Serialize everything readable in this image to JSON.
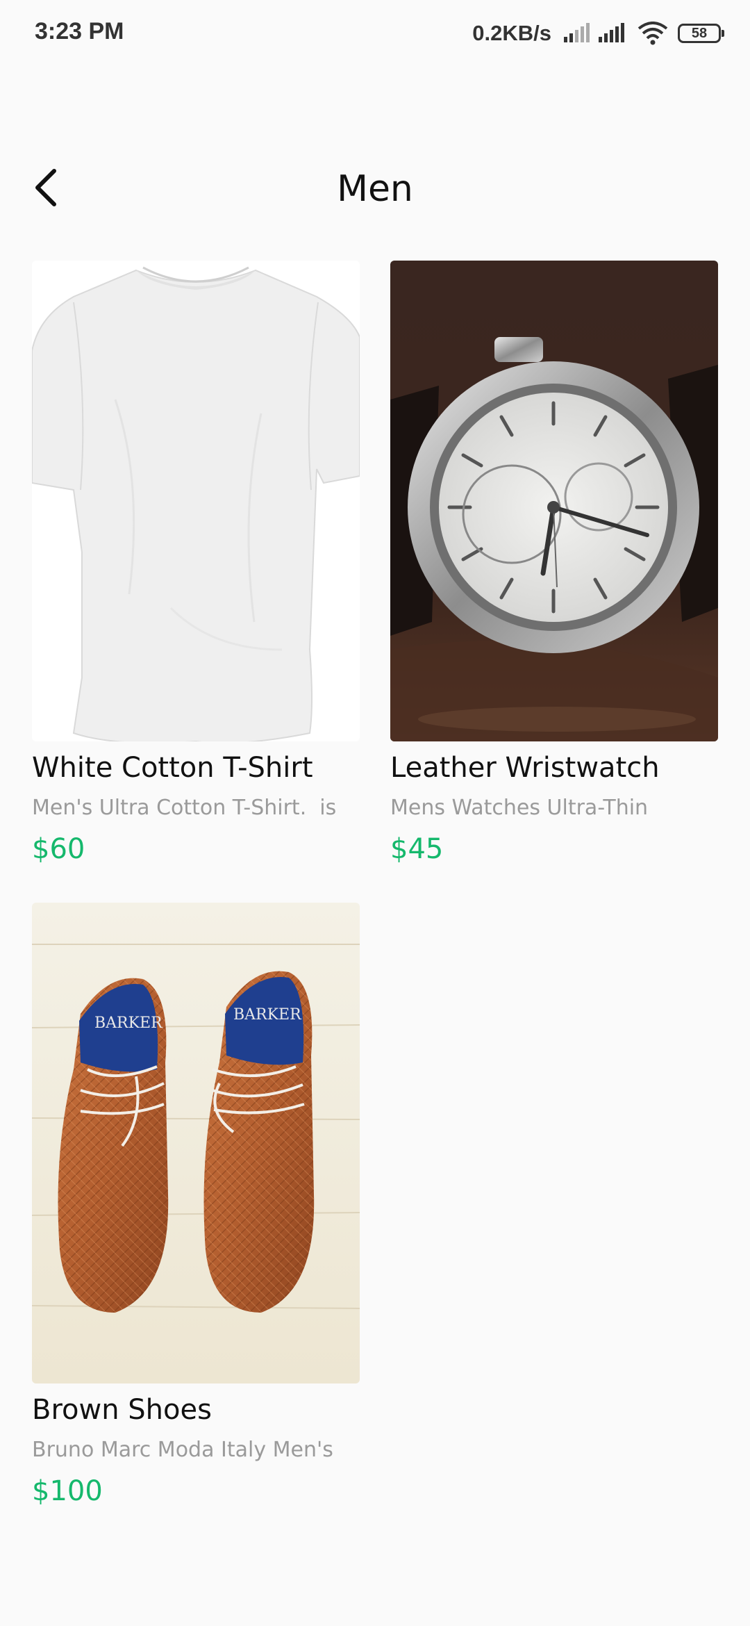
{
  "status_bar": {
    "time": "3:23 PM",
    "net_speed": "0.2KB/s",
    "battery": "58",
    "icons": [
      "signal-icon",
      "signal-icon",
      "wifi-icon",
      "battery-icon"
    ]
  },
  "header": {
    "title": "Men",
    "back_icon": "chevron-left-icon"
  },
  "products": [
    {
      "name": "White Cotton T-Shirt",
      "description": "Men's Ultra Cotton T-Shirt.  is",
      "price": "$60",
      "image": "white-tshirt-photo"
    },
    {
      "name": "Leather Wristwatch",
      "description": "Mens Watches Ultra-Thin",
      "price": "$45",
      "image": "wristwatch-photo"
    },
    {
      "name": "Brown Shoes",
      "description": "Bruno Marc Moda Italy Men's",
      "price": "$100",
      "image": "brown-shoes-photo"
    }
  ],
  "colors": {
    "background": "#fafafa",
    "price": "#15b86c",
    "description": "#9a9a9a",
    "text": "#111111"
  }
}
